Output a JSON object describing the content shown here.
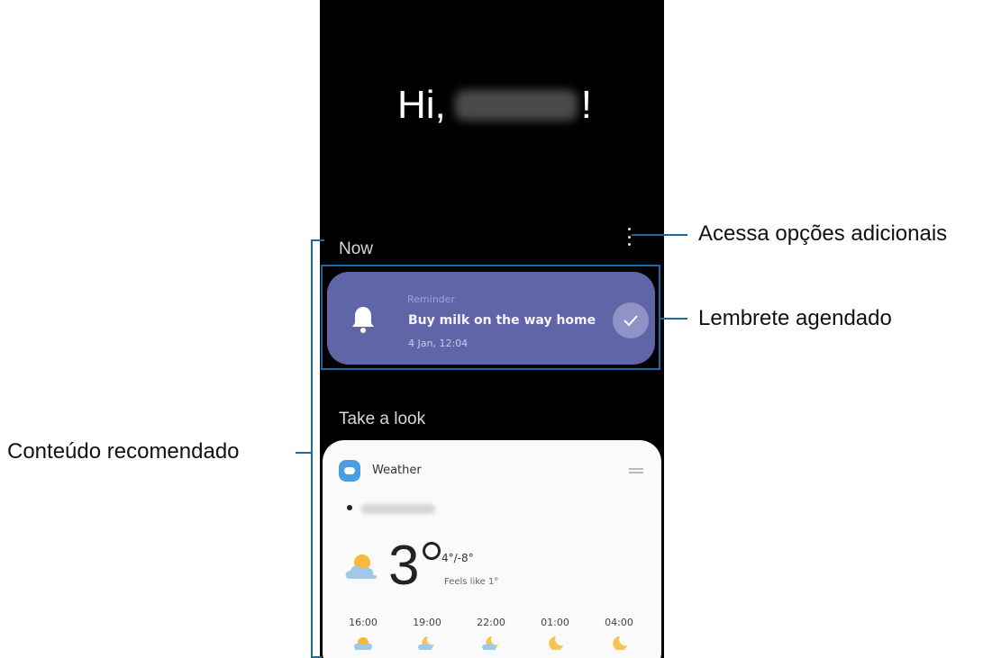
{
  "greeting": {
    "prefix": "Hi,",
    "suffix": "!"
  },
  "now_section": {
    "title": "Now",
    "reminder": {
      "label": "Reminder",
      "title": "Buy milk on the way home",
      "time": "4 Jan, 12:04"
    }
  },
  "look_section": {
    "title": "Take a look",
    "weather": {
      "app_name": "Weather",
      "temperature": "3",
      "hi_lo": "4°/-8°",
      "feels_like": "Feels like 1°",
      "hourly": [
        {
          "time": "16:00",
          "icon": "sun-cloud-icon"
        },
        {
          "time": "19:00",
          "icon": "moon-cloud-icon"
        },
        {
          "time": "22:00",
          "icon": "moon-cloud-icon"
        },
        {
          "time": "01:00",
          "icon": "moon-icon"
        },
        {
          "time": "04:00",
          "icon": "moon-icon"
        }
      ]
    }
  },
  "annotations": {
    "more_options": "Acessa opções adicionais",
    "scheduled_reminder": "Lembrete agendado",
    "recommended_content": "Conteúdo recomendado"
  },
  "colors": {
    "callout_line": "#1a6aa6",
    "reminder_card": "#6065a8"
  }
}
